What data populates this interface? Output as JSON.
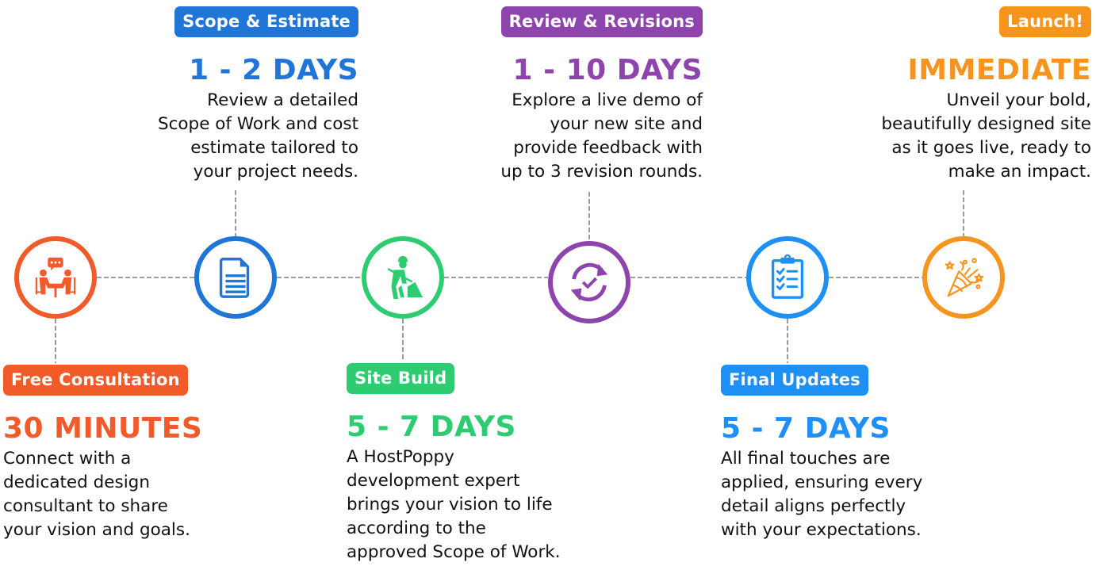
{
  "colors": {
    "orange": "#F15A29",
    "blue": "#2075D9",
    "green": "#2ECC71",
    "purple": "#8E44AD",
    "sky": "#1E90F5",
    "amber": "#F7941D",
    "connector": "#666666"
  },
  "steps": [
    {
      "badge": "Free Consultation",
      "duration": "30 MINUTES",
      "description": [
        "Connect with a",
        "dedicated design",
        "consultant to share",
        "your vision and goals."
      ],
      "icon": "consultation-icon",
      "color": "#F15A29",
      "position": "bottom"
    },
    {
      "badge": "Scope & Estimate",
      "duration": "1 - 2 DAYS",
      "description": [
        "Review a detailed",
        "Scope of Work and cost",
        "estimate tailored to",
        "your project needs."
      ],
      "icon": "document-icon",
      "color": "#2075D9",
      "position": "top"
    },
    {
      "badge": "Site Build",
      "duration": "5 - 7 DAYS",
      "description": [
        "A HostPoppy",
        "development expert",
        "brings your vision to life",
        "according to the",
        "approved Scope of Work."
      ],
      "icon": "construction-worker-icon",
      "color": "#2ECC71",
      "position": "bottom"
    },
    {
      "badge": "Review & Revisions",
      "duration": "1 - 10 DAYS",
      "description": [
        "Explore a live demo of",
        "your new site and",
        "provide feedback with",
        "up to 3 revision rounds."
      ],
      "icon": "refresh-check-icon",
      "color": "#8E44AD",
      "position": "top"
    },
    {
      "badge": "Final Updates",
      "duration": "5 - 7 DAYS",
      "description": [
        "All final touches are",
        "applied, ensuring every",
        "detail aligns perfectly",
        "with your expectations."
      ],
      "icon": "checklist-clipboard-icon",
      "color": "#1E90F5",
      "position": "bottom"
    },
    {
      "badge": "Launch!",
      "duration": "IMMEDIATE",
      "description": [
        "Unveil your bold,",
        "beautifully designed site",
        "as it goes live, ready to",
        "make an impact."
      ],
      "icon": "party-popper-icon",
      "color": "#F7941D",
      "position": "top"
    }
  ]
}
